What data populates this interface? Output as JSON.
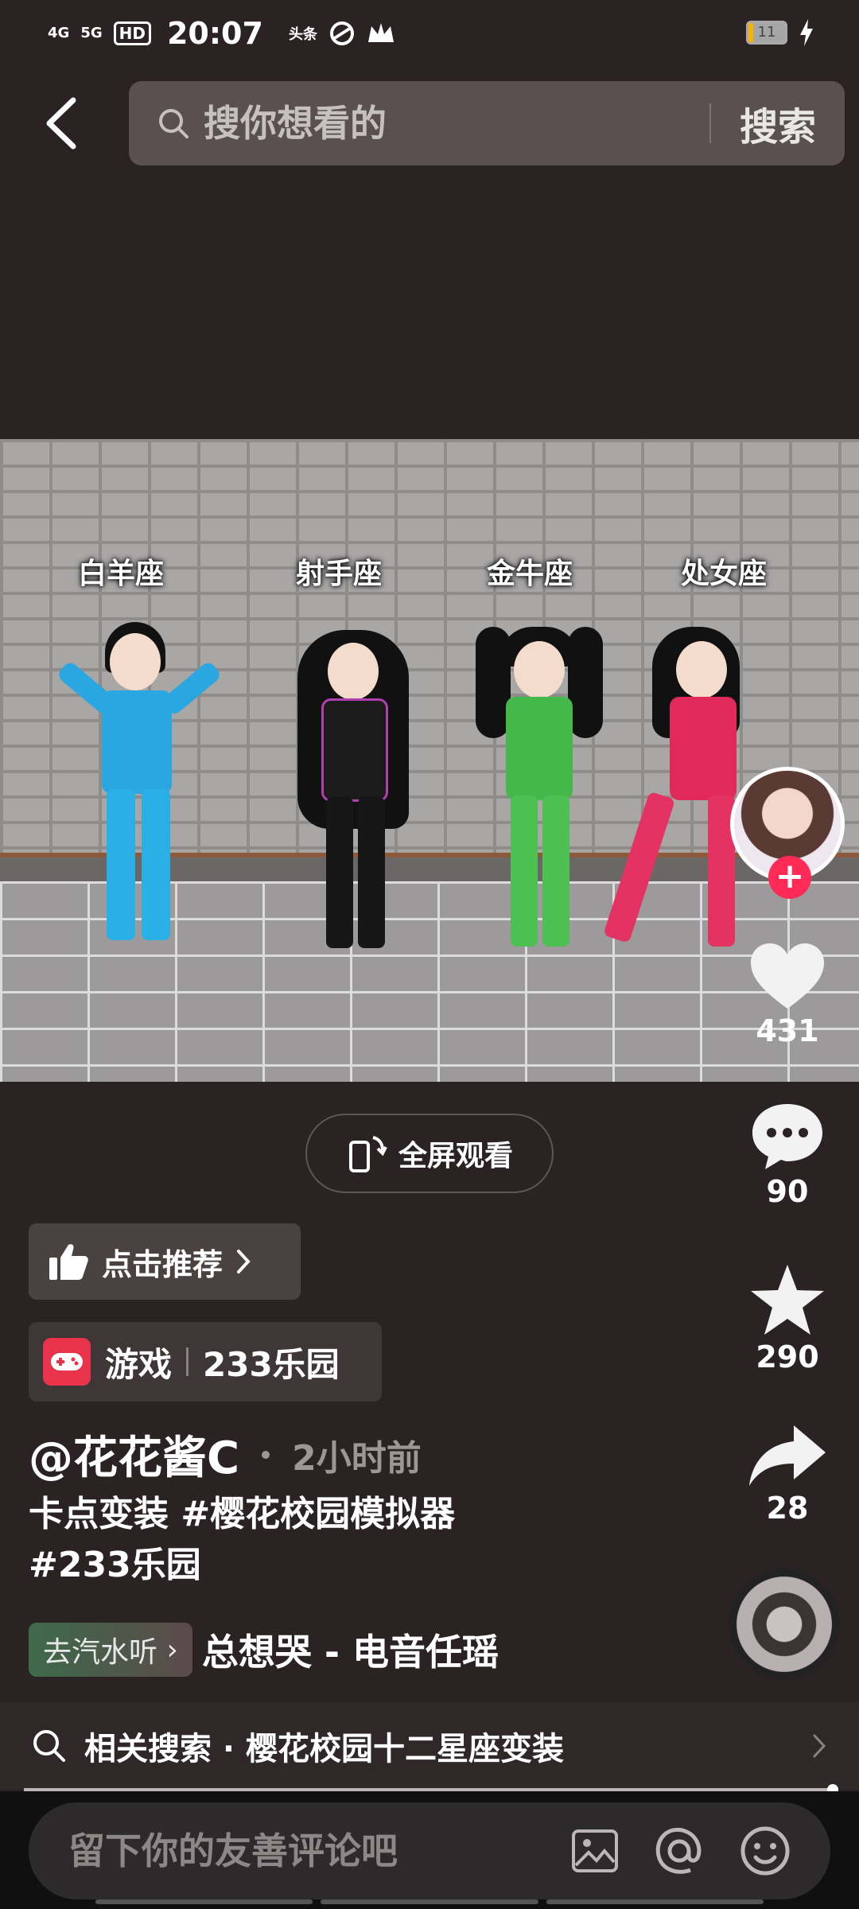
{
  "status_bar": {
    "network_1": "4G",
    "network_2": "5G",
    "hd": "HD",
    "time": "20:07",
    "app_badge": "头条",
    "battery": "11"
  },
  "search": {
    "placeholder": "搜你想看的",
    "button_label": "搜索"
  },
  "video": {
    "signs": [
      "白羊座",
      "射手座",
      "金牛座",
      "处女座"
    ],
    "fullscreen_label": "全屏观看"
  },
  "actions": {
    "likes": "431",
    "comments": "90",
    "favorites": "290",
    "shares": "28"
  },
  "info": {
    "recommend_label": "点击推荐",
    "game_category": "游戏",
    "game_name": "233乐园",
    "author": "@花花酱C",
    "time_ago": "2小时前",
    "caption_line1": "卡点变装 #樱花校园模拟器",
    "caption_line2": "#233乐园",
    "music_go": "去汽水听",
    "music_name": "总想哭 - 电音任瑶"
  },
  "related": {
    "text": "相关搜索 · 樱花校园十二星座变装"
  },
  "comment": {
    "placeholder": "留下你的友善评论吧"
  },
  "colors": {
    "background": "#2b2223",
    "accent_red": "#ff2a55",
    "game_icon": "#e8334a"
  }
}
